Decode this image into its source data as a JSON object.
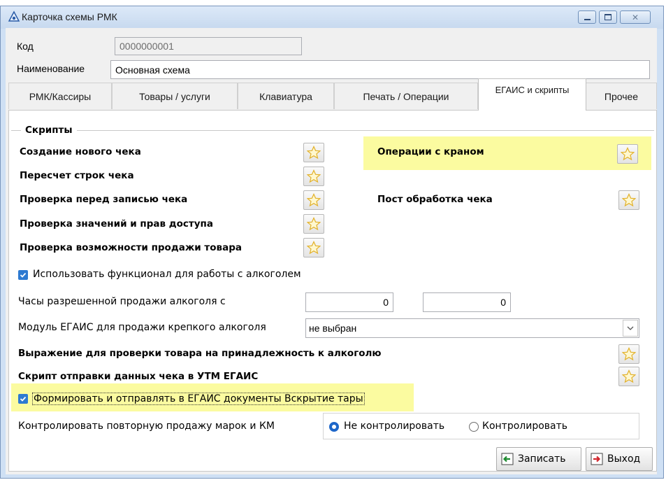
{
  "window": {
    "title": "Карточка схемы РМК"
  },
  "fields": {
    "code_label": "Код",
    "code_value": "0000000001",
    "name_label": "Наименование",
    "name_value": "Основная схема"
  },
  "tabs": [
    {
      "label": "РМК/Кассиры",
      "active": false
    },
    {
      "label": "Товары / услуги",
      "active": false
    },
    {
      "label": "Клавиатура",
      "active": false
    },
    {
      "label": "Печать / Операции",
      "active": false
    },
    {
      "label": "ЕГАИС и скрипты",
      "active": true
    },
    {
      "label": "Прочее",
      "active": false
    }
  ],
  "scripts": {
    "group_title": "Скрипты",
    "left": [
      "Создание нового чека",
      "Пересчет строк чека",
      "Проверка перед записью чека",
      "Проверка значений и прав доступа",
      "Проверка возможности продажи товара"
    ],
    "right": [
      "Операции с краном",
      "Пост обработка чека"
    ]
  },
  "alcohol": {
    "use_checkbox": "Использовать функционал для работы с алкоголем",
    "use_checked": true,
    "hours_label": "Часы разрешенной продажи алкоголя с",
    "hours_from": "0",
    "hours_to": "0",
    "module_label": "Модуль ЕГАИС для продажи крепкого алкоголя",
    "module_value": "не выбран",
    "expr_label": "Выражение для проверки товара на принадлежность к алкоголю",
    "send_script_label": "Скрипт отправки данных чека в УТМ ЕГАИС",
    "form_checkbox": "Формировать и отправлять в ЕГАИС документы Вскрытие тары",
    "form_checked": true,
    "control_label": "Контролировать повторную продажу марок и КМ",
    "radio_no": "Не контролировать",
    "radio_yes": "Контролировать",
    "radio_selected": "no"
  },
  "buttons": {
    "save": "Записать",
    "exit": "Выход"
  },
  "colors": {
    "highlight": "#fbfba0",
    "checkbox": "#2e7ad1",
    "titlebar": "#c7d9ef"
  },
  "icons": [
    "app-icon",
    "star-icon",
    "save-icon",
    "exit-icon"
  ]
}
